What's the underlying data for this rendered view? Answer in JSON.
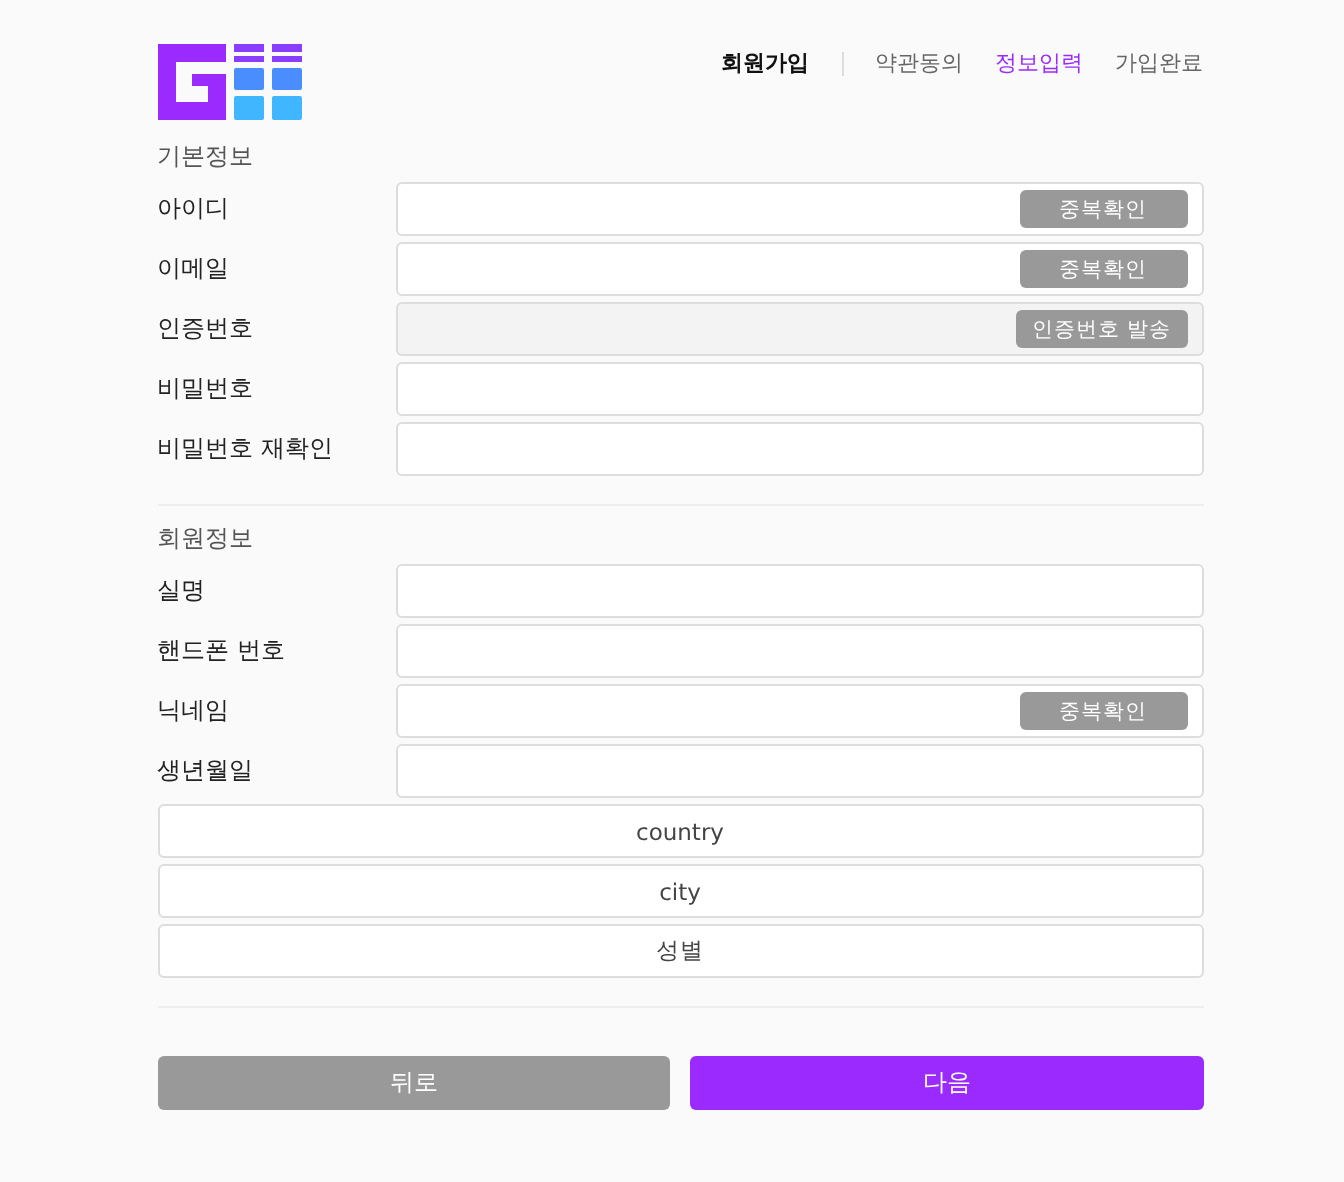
{
  "header": {
    "title": "회원가입",
    "steps": [
      {
        "label": "약관동의",
        "selected": false
      },
      {
        "label": "정보입력",
        "selected": true
      },
      {
        "label": "가입완료",
        "selected": false
      }
    ]
  },
  "sections": [
    {
      "title": "기본정보",
      "fields": [
        {
          "label": "아이디",
          "disabled": false,
          "button": "중복확인"
        },
        {
          "label": "이메일",
          "disabled": false,
          "button": "중복확인"
        },
        {
          "label": "인증번호",
          "disabled": true,
          "button": "인증번호 발송"
        },
        {
          "label": "비밀번호",
          "disabled": false
        },
        {
          "label": "비밀번호 재확인",
          "disabled": false
        }
      ]
    },
    {
      "title": "회원정보",
      "fields": [
        {
          "label": "실명",
          "disabled": false
        },
        {
          "label": "핸드폰 번호",
          "disabled": false
        },
        {
          "label": "닉네임",
          "disabled": false,
          "button": "중복확인"
        },
        {
          "label": "생년월일",
          "disabled": false
        }
      ]
    }
  ],
  "selects": [
    {
      "value": "country"
    },
    {
      "value": "city"
    },
    {
      "value": "성별"
    }
  ],
  "buttons": [
    {
      "label": "뒤로",
      "kind": "secondary"
    },
    {
      "label": "다음",
      "kind": "primary"
    }
  ]
}
